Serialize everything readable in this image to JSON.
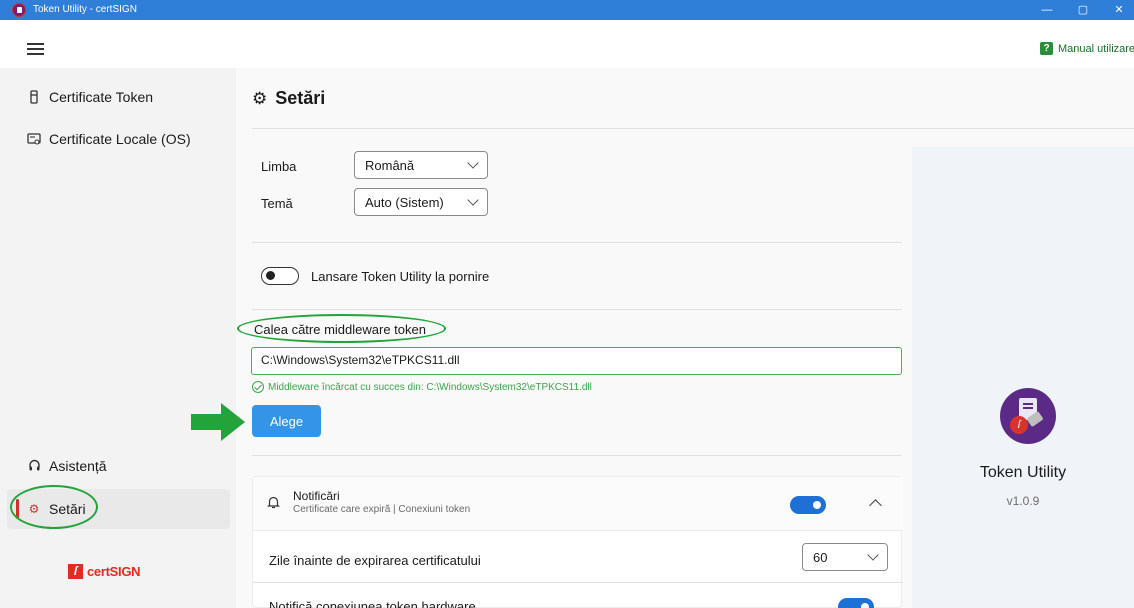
{
  "window": {
    "title": "Token Utility - certSIGN",
    "minimize": "—",
    "maximize": "▢",
    "close": "✕"
  },
  "header": {
    "manual_label": "Manual utilizare",
    "manual_icon_glyph": "?"
  },
  "sidebar": {
    "items": [
      {
        "label": "Certificate Token",
        "icon": "usb-token-icon"
      },
      {
        "label": "Certificate Locale (OS)",
        "icon": "certificate-icon"
      }
    ],
    "bottom_items": [
      {
        "label": "Asistență",
        "icon": "headset-icon"
      },
      {
        "label": "Setări",
        "icon": "gear-icon",
        "selected": true
      }
    ],
    "brand": "certSIGN",
    "brand_mark": "ſ"
  },
  "page": {
    "title": "Setări",
    "language_label": "Limba",
    "language_value": "Română",
    "theme_label": "Temă",
    "theme_value": "Auto (Sistem)",
    "startup_label": "Lansare Token Utility la pornire",
    "startup_enabled": false,
    "middleware_label": "Calea către middleware token",
    "middleware_path": "C:\\Windows\\System32\\eTPKCS11.dll",
    "middleware_status": "Middleware încărcat cu succes din: C:\\Windows\\System32\\eTPKCS11.dll",
    "choose_button": "Alege"
  },
  "notifications": {
    "title": "Notificări",
    "subtitle": "Certificate care expiră | Conexiuni token",
    "enabled": true,
    "days_label": "Zile înainte de expirarea certificatului",
    "days_value": "60",
    "hardware_label": "Notifică conexiunea token hardware",
    "hardware_enabled": true
  },
  "about": {
    "app_name": "Token Utility",
    "version": "v1.0.9"
  },
  "colors": {
    "accent": "#3394e8",
    "toggle_on": "#1e6fd6",
    "annotation": "#22a43a",
    "brand": "#e32b21",
    "success": "#3fa34d"
  }
}
